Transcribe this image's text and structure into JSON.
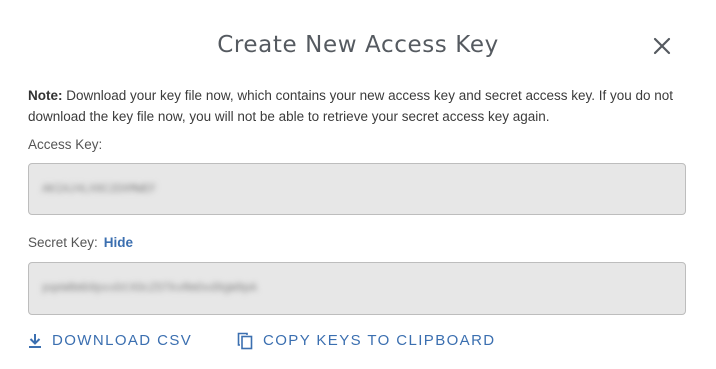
{
  "dialog": {
    "title": "Create New Access Key",
    "close_icon": "close-icon"
  },
  "note": {
    "prefix": "Note:",
    "text": " Download your key file now, which contains your new access key and secret access key. If you do not download the key file now, you will not be able to retrieve your secret access key again."
  },
  "access_key": {
    "label": "Access Key:",
    "value": "AKIAJ4LX6C2DXMWEF"
  },
  "secret_key": {
    "label": "Secret Key:",
    "toggle_label": "Hide",
    "value": "pqeW8mb9pxxbtXOcZSTkvRmOxd9gW9pA"
  },
  "actions": {
    "download_label": "DOWNLOAD CSV",
    "download_icon": "download-icon",
    "copy_label": "COPY KEYS TO CLIPBOARD",
    "copy_icon": "copy-icon"
  },
  "colors": {
    "accent": "#3b6fb0",
    "field_bg": "#e7e7e7",
    "field_border": "#bdbdbd",
    "title": "#555a60"
  }
}
